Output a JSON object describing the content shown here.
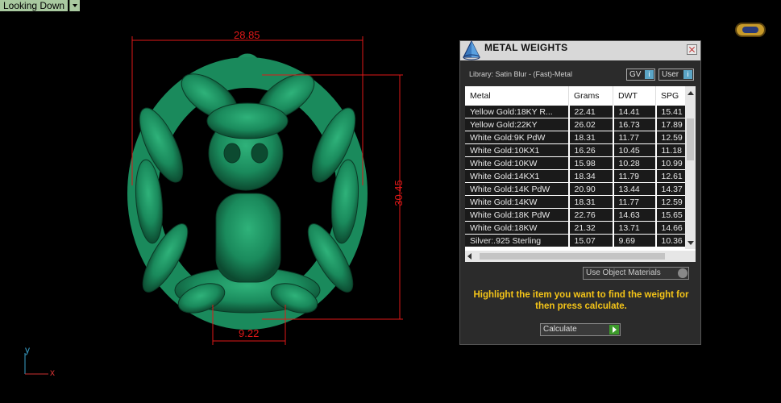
{
  "viewport": {
    "label": "Looking Down"
  },
  "dimensions": {
    "width": "28.85",
    "height": "30.45",
    "base": "9.22"
  },
  "axes": {
    "y": "y",
    "x": "x"
  },
  "panel": {
    "title": "METAL WEIGHTS",
    "library": "Library: Satin Blur - (Fast)-Metal",
    "toggle_gv": "GV",
    "toggle_user": "User",
    "toggle_indicator": "i",
    "columns": [
      "Metal",
      "Grams",
      "DWT",
      "SPG"
    ],
    "rows": [
      [
        "Yellow Gold:18KY R...",
        "22.41",
        "14.41",
        "15.41"
      ],
      [
        "Yellow Gold:22KY",
        "26.02",
        "16.73",
        "17.89"
      ],
      [
        "White Gold:9K PdW",
        "18.31",
        "11.77",
        "12.59"
      ],
      [
        "White Gold:10KX1",
        "16.26",
        "10.45",
        "11.18"
      ],
      [
        "White Gold:10KW",
        "15.98",
        "10.28",
        "10.99"
      ],
      [
        "White Gold:14KX1",
        "18.34",
        "11.79",
        "12.61"
      ],
      [
        "White Gold:14K PdW",
        "20.90",
        "13.44",
        "14.37"
      ],
      [
        "White Gold:14KW",
        "18.31",
        "11.77",
        "12.59"
      ],
      [
        "White Gold:18K PdW",
        "22.76",
        "14.63",
        "15.65"
      ],
      [
        "White Gold:18KW",
        "21.32",
        "13.71",
        "14.66"
      ],
      [
        "Silver:.925 Sterling",
        "15.07",
        "9.69",
        "10.36"
      ]
    ],
    "material_field": "Use Object Materials",
    "hint": "Highlight the item you want to find the weight for then press calculate.",
    "calculate": "Calculate"
  },
  "colors": {
    "dimension_lines": "#e01818",
    "model_green": "#1a8a5c",
    "hint_yellow": "#f5c518"
  }
}
